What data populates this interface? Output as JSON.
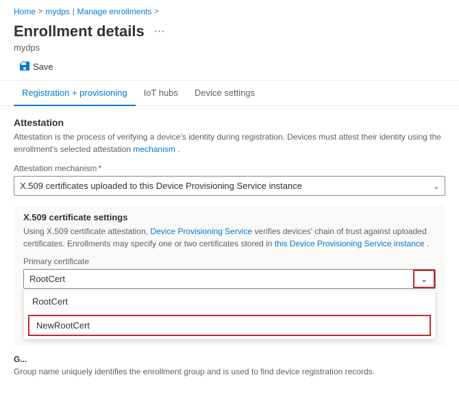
{
  "breadcrumb": {
    "items": [
      "Home",
      "mydps",
      "Manage enrollments"
    ],
    "separators": [
      ">",
      "|",
      ">"
    ]
  },
  "page": {
    "title": "Enrollment details",
    "subtitle": "mydps",
    "ellipsis_label": "···"
  },
  "toolbar": {
    "save_label": "Save"
  },
  "tabs": [
    {
      "id": "registration",
      "label": "Registration + provisioning",
      "active": true
    },
    {
      "id": "iot-hubs",
      "label": "IoT hubs",
      "active": false
    },
    {
      "id": "device-settings",
      "label": "Device settings",
      "active": false
    }
  ],
  "attestation": {
    "section_title": "Attestation",
    "section_desc_part1": "Attestation is the process of verifying a device's identity during registration. Devices must attest their identity using the enrollment's selected attestation",
    "section_desc_link": "mechanism",
    "section_desc_end": ".",
    "mechanism_label": "Attestation mechanism",
    "mechanism_required": "*",
    "mechanism_value": "X.509 certificates uploaded to this Device Provisioning Service instance"
  },
  "cert_settings": {
    "title": "X.509 certificate settings",
    "desc_part1": "Using X.509 certificate attestation,",
    "desc_link": "Device Provisioning Service",
    "desc_part2": "verifies devices' chain of trust against uploaded certificates. Enrollments may specify one or two certificates stored in",
    "desc_link2": "this Device Provisioning Service instance",
    "desc_end": ".",
    "primary_label": "Primary certificate",
    "primary_value": "RootCert",
    "dropdown_options": [
      "RootCert",
      "NewRootCert"
    ]
  },
  "group_name": {
    "label": "G...",
    "desc": "Group name uniquely identifies the enrollment group and is used to find device registration records."
  }
}
